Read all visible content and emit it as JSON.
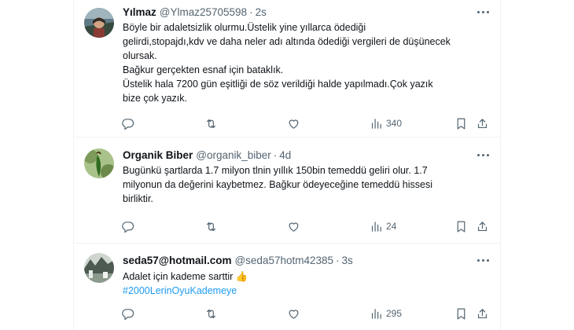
{
  "tweets": [
    {
      "name": "Yılmaz",
      "handle": "@Ylmaz25705598",
      "time": "2s",
      "lines": [
        "Böyle bir adaletsizlik olurmu.Üstelik yine yıllarca ödediği",
        "gelirdi,stopajdı,kdv ve daha neler adı altında ödediği vergileri de düşünecek",
        "olursak.",
        "Bağkur gerçekten esnaf için bataklık.",
        "Üstelik hala 7200 gün eşitliği de söz verildiği halde yapılmadı.Çok yazık",
        "bize çok yazık."
      ],
      "views": "340"
    },
    {
      "name": "Organik Biber",
      "handle": "@organik_biber",
      "time": "4d",
      "lines": [
        "Bugünkü şartlarda 1.7 milyon tlnin yıllık 150bin temeddü geliri olur. 1.7",
        "milyonun da değerini kaybetmez. Bağkur ödeyeceğine temeddü hissesi",
        "birliktir."
      ],
      "views": "24"
    },
    {
      "name": "seda57@hotmail.com",
      "handle": "@seda57hotm42385",
      "time": "3s",
      "lines": [
        "Adalet için kademe sarttir"
      ],
      "emoji": "👍",
      "hashtag": "#2000LerinOyuKademeye",
      "views": "295"
    }
  ],
  "separator": "·",
  "icons": [
    "more-icon",
    "reply-icon",
    "retweet-icon",
    "like-icon",
    "views-icon",
    "bookmark-icon",
    "share-icon"
  ],
  "colors": {
    "text": "#0f1419",
    "secondary": "#536471",
    "link": "#1d9bf0",
    "border": "#eff3f4"
  }
}
